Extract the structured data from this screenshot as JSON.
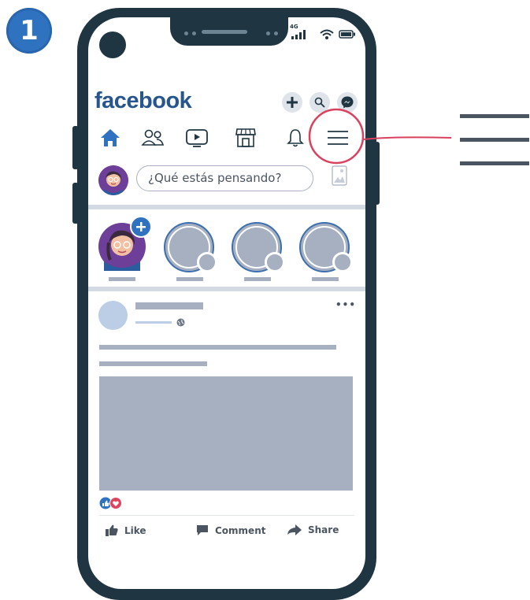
{
  "step": {
    "number": "1"
  },
  "status_bar": {
    "network": "4G"
  },
  "app": {
    "logo": "facebook"
  },
  "header_actions": [
    {
      "name": "create",
      "icon": "plus-icon"
    },
    {
      "name": "search",
      "icon": "search-icon"
    },
    {
      "name": "messenger",
      "icon": "messenger-icon"
    }
  ],
  "nav_tabs": [
    {
      "name": "home",
      "icon": "home-icon",
      "active": true
    },
    {
      "name": "friends",
      "icon": "friends-icon"
    },
    {
      "name": "watch",
      "icon": "video-icon"
    },
    {
      "name": "marketplace",
      "icon": "store-icon"
    },
    {
      "name": "notifications",
      "icon": "bell-icon"
    },
    {
      "name": "menu",
      "icon": "hamburger-menu-icon",
      "highlighted": true
    }
  ],
  "composer": {
    "placeholder": "¿Qué estás pensando?"
  },
  "post": {
    "more": "•••",
    "actions": {
      "like": "Like",
      "comment": "Comment",
      "share": "Share"
    }
  },
  "colors": {
    "brand": "#27568f",
    "highlight_circle": "#d9415e",
    "skeleton": "#a6b0c1",
    "phone": "#1f3542"
  }
}
